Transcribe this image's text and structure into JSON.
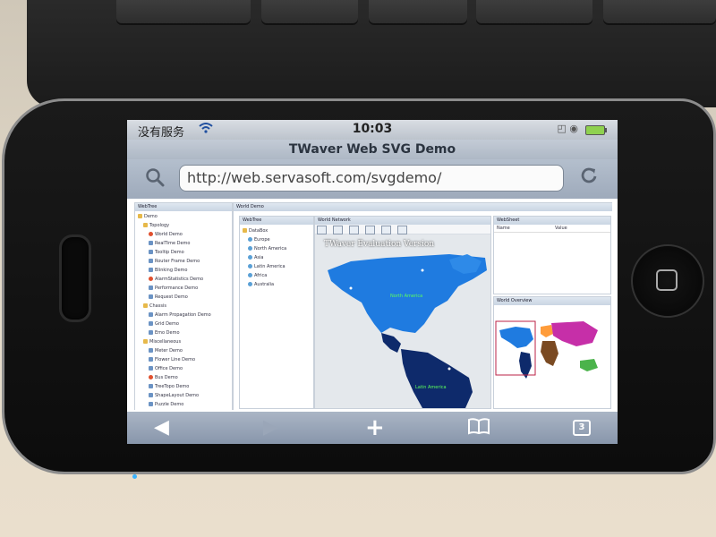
{
  "statusbar": {
    "carrier": "没有服务",
    "time": "10:03"
  },
  "browser": {
    "page_title": "TWaver Web SVG Demo",
    "url": "http://web.servasoft.com/svgdemo/",
    "tabs_count": "3"
  },
  "app": {
    "left_panel_title": "WebTree",
    "right_panel_title": "World Demo",
    "tree": [
      {
        "label": "Demo",
        "icon": "folder-icon",
        "level": 0
      },
      {
        "label": "Topology",
        "icon": "folder-icon",
        "level": 1
      },
      {
        "label": "World Demo",
        "icon": "star-icon",
        "level": 2
      },
      {
        "label": "RealTime Demo",
        "icon": "node-icon",
        "level": 2
      },
      {
        "label": "Tooltip Demo",
        "icon": "node-icon",
        "level": 2
      },
      {
        "label": "Router Frame Demo",
        "icon": "node-icon",
        "level": 2
      },
      {
        "label": "Blinking Demo",
        "icon": "node-icon",
        "level": 2
      },
      {
        "label": "AlarmStatistics Demo",
        "icon": "star-icon",
        "level": 2
      },
      {
        "label": "Performance Demo",
        "icon": "node-icon",
        "level": 2
      },
      {
        "label": "Request Demo",
        "icon": "node-icon",
        "level": 2
      },
      {
        "label": "Chassis",
        "icon": "folder-icon",
        "level": 1
      },
      {
        "label": "Alarm Propagation Demo",
        "icon": "node-icon",
        "level": 2
      },
      {
        "label": "Grid Demo",
        "icon": "node-icon",
        "level": 2
      },
      {
        "label": "Emo Demo",
        "icon": "node-icon",
        "level": 2
      },
      {
        "label": "Miscellaneous",
        "icon": "folder-icon",
        "level": 1
      },
      {
        "label": "Meter Demo",
        "icon": "node-icon",
        "level": 2
      },
      {
        "label": "Flower Line Demo",
        "icon": "node-icon",
        "level": 2
      },
      {
        "label": "Office Demo",
        "icon": "node-icon",
        "level": 2
      },
      {
        "label": "Bus Demo",
        "icon": "star-icon",
        "level": 2
      },
      {
        "label": "TreeTopo Demo",
        "icon": "node-icon",
        "level": 2
      },
      {
        "label": "ShapeLayout Demo",
        "icon": "node-icon",
        "level": 2
      },
      {
        "label": "Puzzle Demo",
        "icon": "node-icon",
        "level": 2
      }
    ],
    "world_tree_title": "WebTree",
    "world_tree": [
      {
        "label": "DataBox",
        "icon": "folder-icon",
        "level": 0
      },
      {
        "label": "Europe",
        "icon": "globe-icon",
        "level": 1
      },
      {
        "label": "North America",
        "icon": "globe-icon",
        "level": 1
      },
      {
        "label": "Asia",
        "icon": "globe-icon",
        "level": 1
      },
      {
        "label": "Latin America",
        "icon": "globe-icon",
        "level": 1
      },
      {
        "label": "Africa",
        "icon": "globe-icon",
        "level": 1
      },
      {
        "label": "Australia",
        "icon": "globe-icon",
        "level": 1
      }
    ],
    "network_title": "World Network",
    "map_caption": "TWaver Evaluation Version",
    "map_labels": {
      "north_america": "North America",
      "latin_america": "Latin America"
    },
    "sheet_title": "WebSheet",
    "sheet_columns": [
      "Name",
      "Value"
    ],
    "overview_title": "World Overview"
  },
  "colors": {
    "accent": "#3b79c9",
    "map_land": "#1f7be0",
    "map_dark": "#0e2a6b"
  }
}
